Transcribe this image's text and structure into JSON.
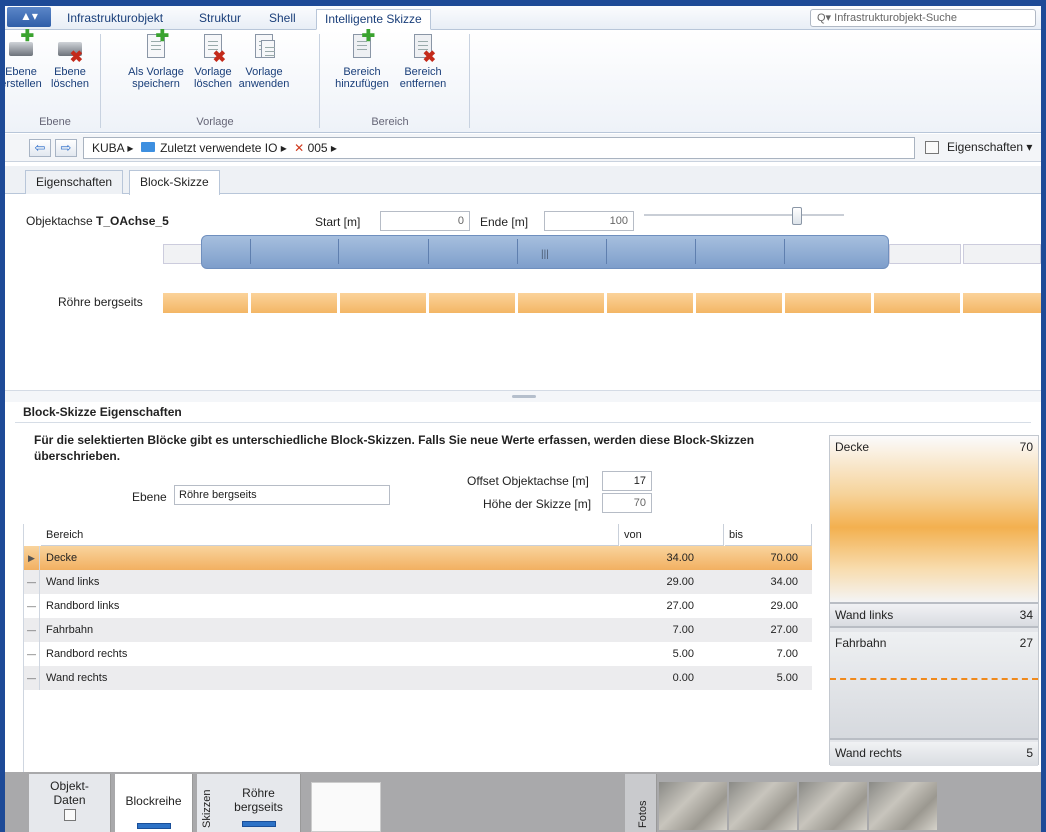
{
  "ribbon_tabs": {
    "app": "▲▾",
    "items": [
      "Infrastrukturobjekt",
      "Struktur",
      "Shell",
      "Intelligente Skizze"
    ],
    "search_placeholder": "Q▾ Infrastrukturobjekt-Suche"
  },
  "ribbon": {
    "ebene_erstellen": "Ebene\nerstellen",
    "ebene_loeschen": "Ebene\nlöschen",
    "grp_ebene": "Ebene",
    "als_vorlage": "Als Vorlage\nspeichern",
    "vorlage_loeschen": "Vorlage\nlöschen",
    "vorlage_anwenden": "Vorlage\nanwenden",
    "grp_vorlage": "Vorlage",
    "bereich_hinzu": "Bereich\nhinzufügen",
    "bereich_entf": "Bereich\nentfernen",
    "grp_bereich": "Bereich"
  },
  "address": {
    "back": "⇦",
    "forward": "⇨",
    "crumb1": "KUBA ▸",
    "crumb2": "Zuletzt verwendete IO ▸",
    "crumb3": "005 ▸",
    "eigenschaften": "Eigenschaften ▾"
  },
  "content_tabs": [
    "Eigenschaften",
    "Block-Skizze"
  ],
  "sketch": {
    "objektachse_label": "Objektachse",
    "objektachse_value": "T_OAchse_5",
    "start_label": "Start [m]",
    "start_value": "0",
    "ende_label": "Ende [m]",
    "ende_value": "100",
    "slider_fraction": 0.78,
    "layer_label": "Röhre bergseits"
  },
  "props": {
    "title": "Block-Skizze Eigenschaften",
    "message": "Für die selektierten Blöcke gibt es unterschiedliche Block-Skizzen. Falls Sie neue Werte erfassen, werden diese Block-Skizzen überschrieben.",
    "ebene_label": "Ebene",
    "ebene_value": "Röhre bergseits",
    "offset_label": "Offset Objektachse [m]",
    "offset_value": "17",
    "hoehe_label": "Höhe der Skizze [m]",
    "hoehe_value": "70",
    "col_bereich": "Bereich",
    "col_von": "von",
    "col_bis": "bis",
    "rows": [
      {
        "name": "Decke",
        "von": "34.00",
        "bis": "70.00"
      },
      {
        "name": "Wand links",
        "von": "29.00",
        "bis": "34.00"
      },
      {
        "name": "Randbord links",
        "von": "27.00",
        "bis": "29.00"
      },
      {
        "name": "Fahrbahn",
        "von": "7.00",
        "bis": "27.00"
      },
      {
        "name": "Randbord rechts",
        "von": "5.00",
        "bis": "7.00"
      },
      {
        "name": "Wand rechts",
        "von": "0.00",
        "bis": "5.00"
      }
    ],
    "preview": [
      {
        "name": "Decke",
        "value": "70"
      },
      {
        "name": "Wand links",
        "value": "34"
      },
      {
        "name": "Fahrbahn",
        "value": "27"
      },
      {
        "name": "Wand rechts",
        "value": "5"
      }
    ]
  },
  "bottom": {
    "objekt_daten": "Objekt-\nDaten",
    "blockreihe": "Blockreihe",
    "skizzen": "Skizzen",
    "roehre": "Röhre\nbergseits",
    "fotos": "Fotos"
  },
  "colors": {
    "accent": "#1e4a97",
    "selection": "#f2b061",
    "link": "#1a3f7a"
  }
}
